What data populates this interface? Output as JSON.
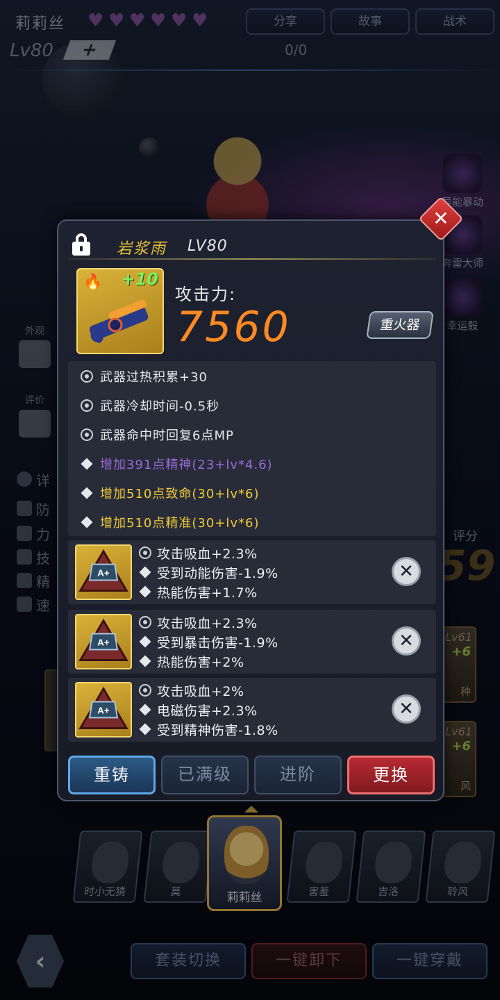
{
  "header": {
    "character_name": "莉莉丝",
    "level": "Lv80",
    "plus_icon": "+",
    "exp": "0/0",
    "hearts": 6,
    "tabs": [
      "分享",
      "故事",
      "战术"
    ]
  },
  "right_skills": [
    "异能暴动",
    "奔雷大师",
    "幸运骰"
  ],
  "left_menu": {
    "appearance": "外观",
    "review": "评价",
    "detail_partial": "详",
    "stats_partial": [
      "防",
      "力",
      "技",
      "精",
      "速"
    ]
  },
  "score": {
    "label": "评分",
    "value_partial": "59"
  },
  "side_cards": [
    {
      "level": "Lv61",
      "plus": "+6",
      "name": "种"
    },
    {
      "level": "Lv61",
      "plus": "+6",
      "name": "风"
    }
  ],
  "modal": {
    "weapon_name": "岩浆雨",
    "weapon_level": "LV80",
    "enhance": "+10",
    "attack_label": "攻击力:",
    "attack_value": "7560",
    "weapon_type": "重火器",
    "attributes": [
      {
        "icon": "gear-icon",
        "text": "武器过热积累+30",
        "color": "#e4e7ec"
      },
      {
        "icon": "gear-icon",
        "text": "武器冷却时间-0.5秒",
        "color": "#e4e7ec"
      },
      {
        "icon": "gear-icon",
        "text": "武器命中时回复6点MP",
        "color": "#e4e7ec"
      },
      {
        "icon": "diamond-icon",
        "text": "增加391点精神(23+lv*4.6)",
        "color": "#9a6ad8"
      },
      {
        "icon": "diamond-icon",
        "text": "增加510点致命(30+lv*6)",
        "color": "#f0c93a"
      },
      {
        "icon": "diamond-icon",
        "text": "增加510点精准(30+lv*6)",
        "color": "#f0c93a"
      }
    ],
    "gems": [
      {
        "lines": [
          "攻击吸血+2.3%",
          "受到动能伤害-1.9%",
          "热能伤害+1.7%"
        ]
      },
      {
        "lines": [
          "攻击吸血+2.3%",
          "受到暴击伤害-1.9%",
          "热能伤害+2%"
        ]
      },
      {
        "lines": [
          "攻击吸血+2%",
          "电磁伤害+2.3%",
          "受到精神伤害-1.8%"
        ]
      }
    ],
    "buttons": {
      "reforge": "重铸",
      "maxed": "已满级",
      "advance": "进阶",
      "replace": "更换"
    },
    "close_icon": "✕"
  },
  "roster": [
    "时小无猜",
    "莫",
    "莉莉丝",
    "害羞",
    "吉洛",
    "聆风"
  ],
  "bottom": {
    "back_icon": "‹",
    "set_switch": "套装切换",
    "unequip_all": "一键卸下",
    "equip_all": "一键穿戴"
  }
}
